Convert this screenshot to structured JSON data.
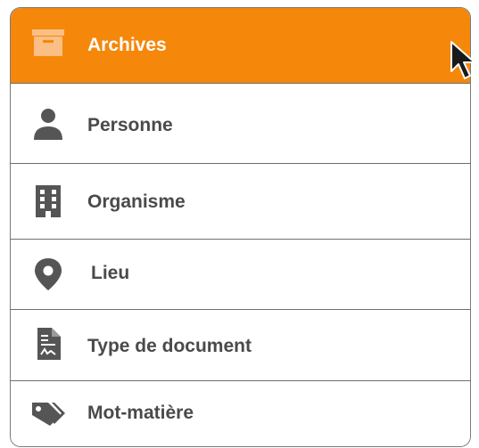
{
  "menu": {
    "items": [
      {
        "label": "Archives",
        "icon": "archive-box-icon"
      },
      {
        "label": "Personne",
        "icon": "person-icon"
      },
      {
        "label": "Organisme",
        "icon": "building-icon"
      },
      {
        "label": "Lieu",
        "icon": "location-pin-icon"
      },
      {
        "label": "Type de document",
        "icon": "document-type-icon"
      },
      {
        "label": "Mot-matière",
        "icon": "tags-icon"
      }
    ],
    "active_index": 0
  },
  "colors": {
    "accent": "#f5870b",
    "accent_light": "#fbbf85",
    "icon_gray": "#555555",
    "text": "#4a4a4a"
  }
}
